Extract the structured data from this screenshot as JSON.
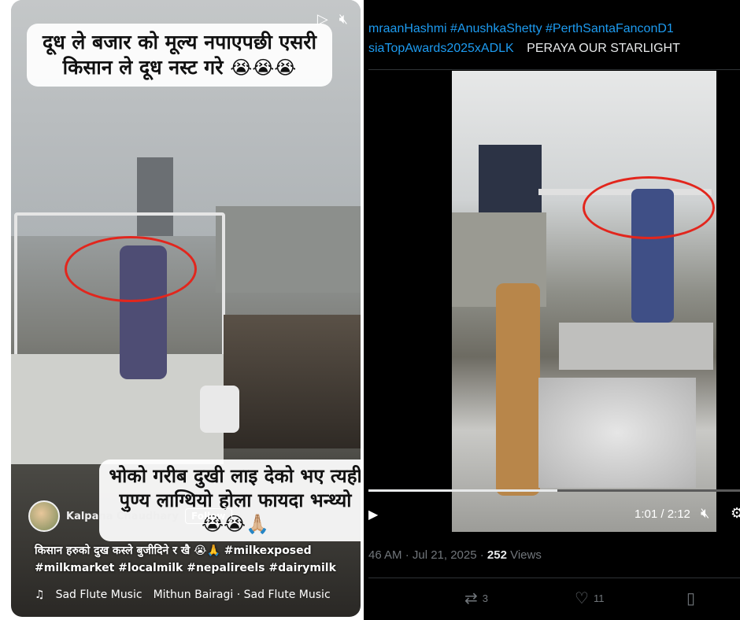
{
  "left": {
    "caption_top": "दूध ले बजार को मूल्य नपाएपछी एसरी किसान ले दूध नस्ट गरे",
    "caption_top_emoji": "😭😭😭",
    "caption_bottom": "भोको गरीब दुखी लाइ देको भए त्यही पुण्य लाग्थियो होला फायदा भन्थ्यो",
    "caption_bottom_emoji": "😭😭🙏🏼",
    "author": "Kalpana Chaudhary",
    "follow_label": "Follow",
    "hash_line_1": "किसान हरुको दुख कस्ले बुजीदिने र खै 😭🙏 #milkexposed",
    "hash_line_2": "#milkmarket #localmilk #nepalireels #dairymilk",
    "music_1": "Sad Flute Music",
    "music_2": "Mithun Bairagi · Sad Flute Music",
    "icons": [
      "play-icon",
      "mute-icon"
    ]
  },
  "right": {
    "tags_line": [
      "mraanHashmi",
      "#AnushkaShetty",
      "#PerthSantaFanconD1"
    ],
    "line2_tag": "siaTopAwards2025xADLK",
    "line2_plain": "PERAYA OUR STARLIGHT",
    "time": "1:01 / 2:12",
    "meta_time": "46 AM · Jul 21, 2025 · ",
    "views_count": "252",
    "views_label": " Views",
    "retweets": "3",
    "likes": "11",
    "accent": "#1d9bf0"
  }
}
